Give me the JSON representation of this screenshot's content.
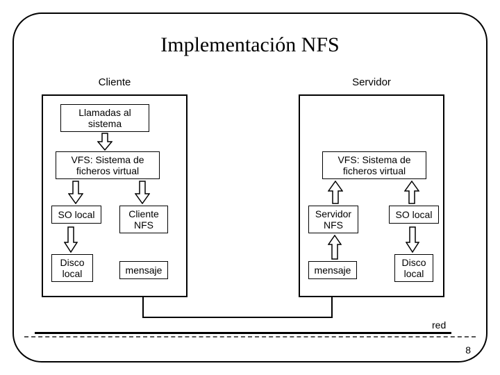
{
  "title": "Implementación NFS",
  "columns": {
    "client": "Cliente",
    "server": "Servidor"
  },
  "client": {
    "llamadas": "Llamadas al sistema",
    "vfs": "VFS: Sistema de ficheros virtual",
    "so_local": "SO local",
    "cliente_nfs": "Cliente NFS",
    "disco": "Disco local",
    "mensaje": "mensaje"
  },
  "server": {
    "vfs": "VFS: Sistema de ficheros virtual",
    "servidor_nfs": "Servidor NFS",
    "so_local": "SO local",
    "mensaje": "mensaje",
    "disco": "Disco local"
  },
  "network_label": "red",
  "page_number": "8"
}
